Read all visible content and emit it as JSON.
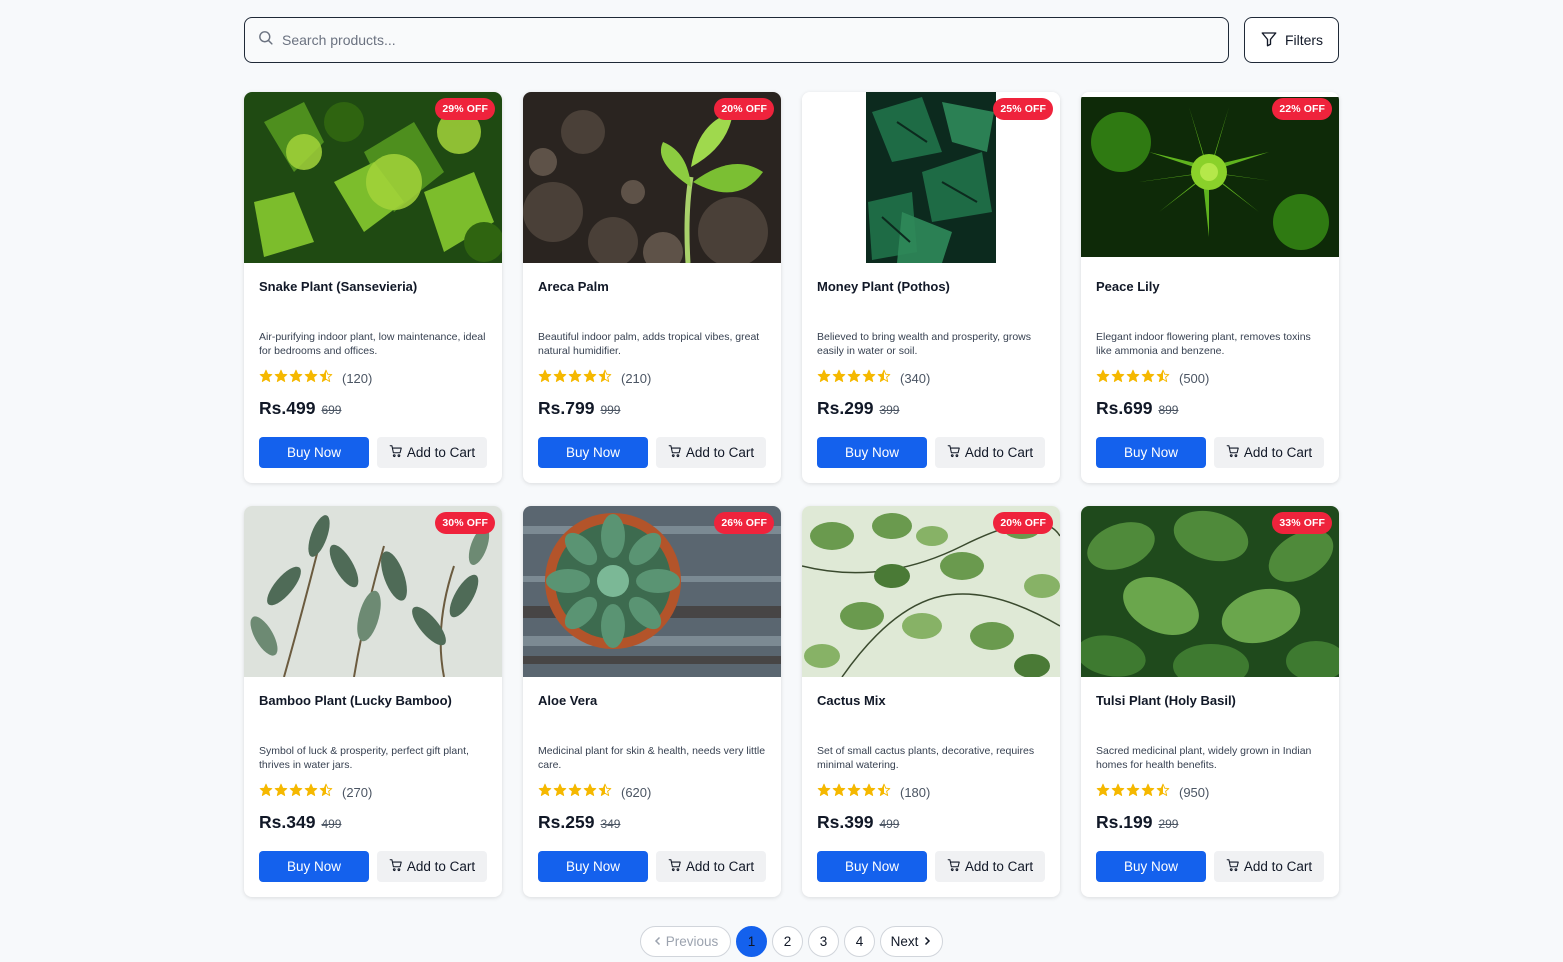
{
  "search": {
    "placeholder": "Search products..."
  },
  "filters_label": "Filters",
  "products": [
    {
      "name": "Snake Plant (Sansevieria)",
      "desc": "Air-purifying indoor plant, low maintenance, ideal for bedrooms and offices.",
      "discount": "29% OFF",
      "reviews": "(120)",
      "price": "Rs.499",
      "original": "699",
      "rating": 4.5
    },
    {
      "name": "Areca Palm",
      "desc": "Beautiful indoor palm, adds tropical vibes, great natural humidifier.",
      "discount": "20% OFF",
      "reviews": "(210)",
      "price": "Rs.799",
      "original": "999",
      "rating": 4.5
    },
    {
      "name": "Money Plant (Pothos)",
      "desc": "Believed to bring wealth and prosperity, grows easily in water or soil.",
      "discount": "25% OFF",
      "reviews": "(340)",
      "price": "Rs.299",
      "original": "399",
      "rating": 4.5
    },
    {
      "name": "Peace Lily",
      "desc": "Elegant indoor flowering plant, removes toxins like ammonia and benzene.",
      "discount": "22% OFF",
      "reviews": "(500)",
      "price": "Rs.699",
      "original": "899",
      "rating": 4.5
    },
    {
      "name": "Bamboo Plant (Lucky Bamboo)",
      "desc": "Symbol of luck & prosperity, perfect gift plant, thrives in water jars.",
      "discount": "30% OFF",
      "reviews": "(270)",
      "price": "Rs.349",
      "original": "499",
      "rating": 4.5
    },
    {
      "name": "Aloe Vera",
      "desc": "Medicinal plant for skin & health, needs very little care.",
      "discount": "26% OFF",
      "reviews": "(620)",
      "price": "Rs.259",
      "original": "349",
      "rating": 4.5
    },
    {
      "name": "Cactus Mix",
      "desc": "Set of small cactus plants, decorative, requires minimal watering.",
      "discount": "20% OFF",
      "reviews": "(180)",
      "price": "Rs.399",
      "original": "499",
      "rating": 4.5
    },
    {
      "name": "Tulsi Plant (Holy Basil)",
      "desc": "Sacred medicinal plant, widely grown in Indian homes for health benefits.",
      "discount": "33% OFF",
      "reviews": "(950)",
      "price": "Rs.199",
      "original": "299",
      "rating": 4.5
    }
  ],
  "buttons": {
    "buy": "Buy Now",
    "cart": "Add to Cart"
  },
  "pagination": {
    "previous": "Previous",
    "next": "Next",
    "pages": [
      "1",
      "2",
      "3",
      "4"
    ],
    "current": "1"
  },
  "colors": {
    "primary": "#1461ed",
    "badge": "#ef233c",
    "star": "#f5b800"
  }
}
